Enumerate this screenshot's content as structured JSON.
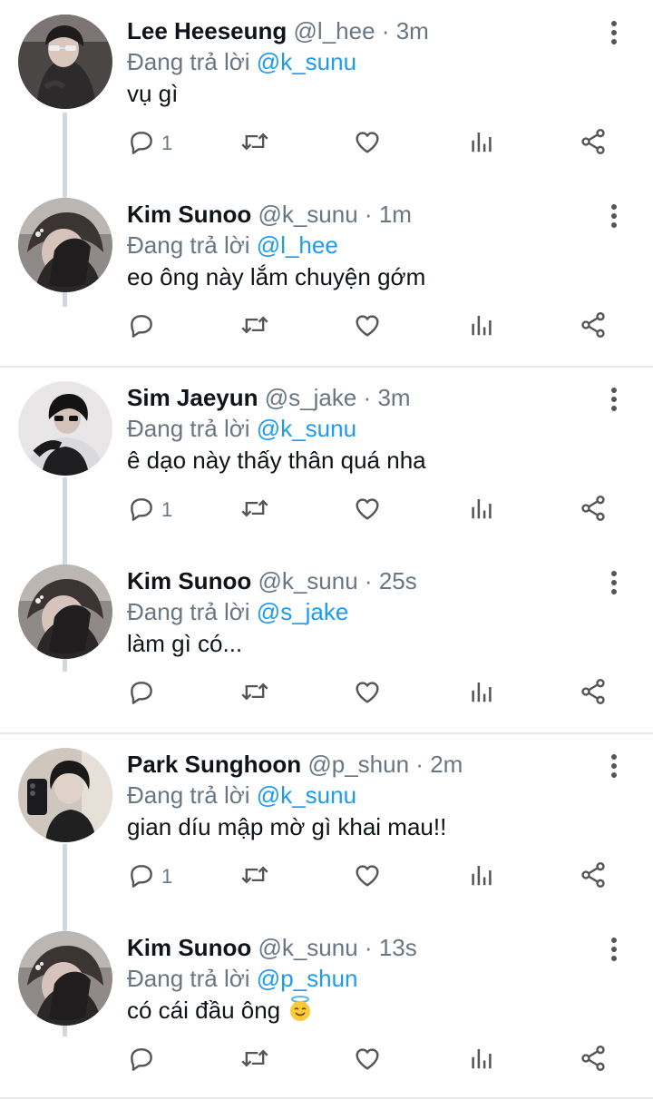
{
  "replying_label": "Đang trả lời",
  "tweets": [
    {
      "name": "Lee Heeseung",
      "handle": "@l_hee",
      "dot": "·",
      "time": "3m",
      "mention": "@k_sunu",
      "text": "vụ gì",
      "reply_count": "1",
      "avatar": "avatar-heeseung"
    },
    {
      "name": "Kim Sunoo",
      "handle": "@k_sunu",
      "dot": "·",
      "time": "1m",
      "mention": "@l_hee",
      "text": "eo ông này lắm chuyện gớm",
      "reply_count": "",
      "avatar": "avatar-sunoo"
    },
    {
      "name": "Sim Jaeyun",
      "handle": "@s_jake",
      "dot": "·",
      "time": "3m",
      "mention": "@k_sunu",
      "text": "ê dạo này thấy thân quá nha",
      "reply_count": "1",
      "avatar": "avatar-jaeyun"
    },
    {
      "name": "Kim Sunoo",
      "handle": "@k_sunu",
      "dot": "·",
      "time": "25s",
      "mention": "@s_jake",
      "text": "làm gì có...",
      "reply_count": "",
      "avatar": "avatar-sunoo"
    },
    {
      "name": "Park Sunghoon",
      "handle": "@p_shun",
      "dot": "·",
      "time": "2m",
      "mention": "@k_sunu",
      "text": "gian díu mập mờ gì khai mau!!",
      "reply_count": "1",
      "avatar": "avatar-sunghoon"
    },
    {
      "name": "Kim Sunoo",
      "handle": "@k_sunu",
      "dot": "·",
      "time": "13s",
      "mention": "@p_shun",
      "text": "có cái đầu ông",
      "reply_count": "",
      "avatar": "avatar-sunoo",
      "emoji": "smiling-face-with-halo-emoji"
    }
  ],
  "icons": {
    "reply": "reply-icon",
    "retweet": "retweet-icon",
    "like": "heart-icon",
    "views": "views-icon",
    "share": "share-icon",
    "more": "more-vertical-icon"
  },
  "colors": {
    "mention": "#1d9bf0",
    "secondary_text": "#687684",
    "thread_line": "#cfd9de",
    "divider": "#e6e9ec"
  }
}
